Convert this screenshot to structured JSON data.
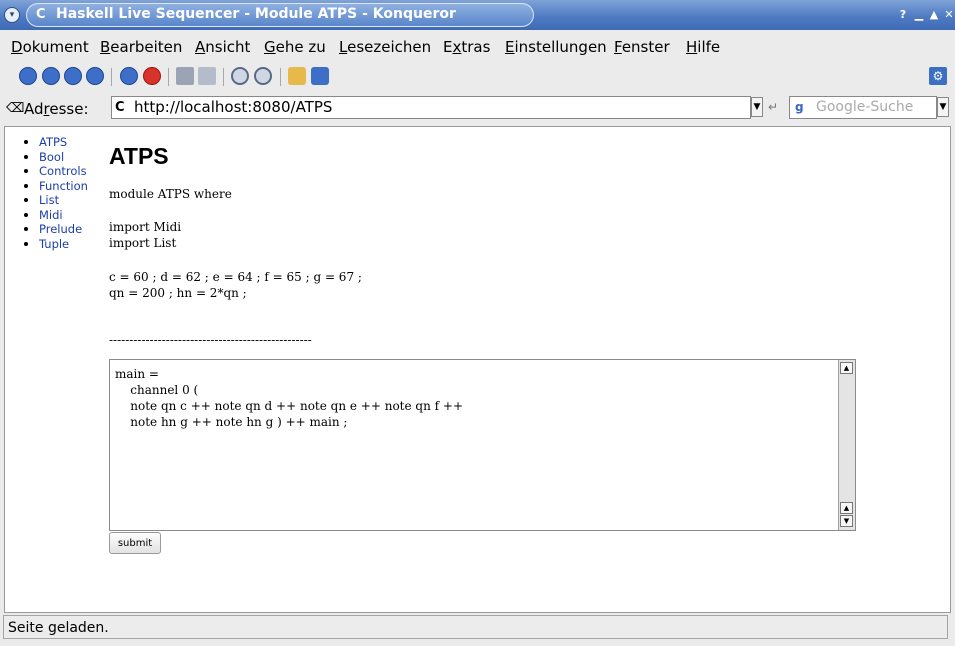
{
  "window": {
    "title": "Haskell Live Sequencer - Module ATPS - Konqueror"
  },
  "menu": {
    "items": [
      {
        "label": "Dokument",
        "accel": "D",
        "rest": "okument"
      },
      {
        "label": "Bearbeiten",
        "accel": "B",
        "rest": "earbeiten"
      },
      {
        "label": "Ansicht",
        "accel": "A",
        "rest": "nsicht"
      },
      {
        "label": "Gehe zu",
        "accel": "G",
        "rest": "ehe zu"
      },
      {
        "label": "Lesezeichen",
        "accel": "L",
        "rest": "esezeichen"
      },
      {
        "label": "Extras",
        "pre": "E",
        "accel": "x",
        "rest": "tras"
      },
      {
        "label": "Einstellungen",
        "accel": "E",
        "rest": "instellungen"
      },
      {
        "label": "Fenster",
        "accel": "F",
        "rest": "enster"
      },
      {
        "label": "Hilfe",
        "accel": "H",
        "rest": "ilfe"
      }
    ]
  },
  "toolbar": {
    "icons": [
      "back-icon",
      "forward-icon",
      "up-icon",
      "home-icon",
      "reload-icon",
      "stop-icon",
      "print-icon",
      "print-preview-icon",
      "zoom-in-icon",
      "zoom-out-icon",
      "security-icon",
      "bookmark-icon",
      "kde-logo-icon"
    ]
  },
  "location": {
    "label_pre": "Ad",
    "label_accel": "r",
    "label_post": "esse:",
    "url": "http://localhost:8080/ATPS",
    "search_placeholder": "Google-Suche"
  },
  "nav": {
    "items": [
      "ATPS",
      "Bool",
      "Controls",
      "Function",
      "List",
      "Midi",
      "Prelude",
      "Tuple"
    ]
  },
  "page": {
    "title": "ATPS",
    "code_module": "module ATPS where",
    "code_imports": "import Midi\nimport List",
    "code_defs": "c = 60 ; d = 62 ; e = 64 ; f = 65 ; g = 67 ;\nqn = 200 ; hn = 2*qn ;",
    "separator": "--------------------------------------------------",
    "editor_text": "main =\n    channel 0 (\n    note qn c ++ note qn d ++ note qn e ++ note qn f ++\n    note hn g ++ note hn g ) ++ main ;",
    "submit_label": "submit"
  },
  "status": {
    "text": "Seite geladen."
  }
}
